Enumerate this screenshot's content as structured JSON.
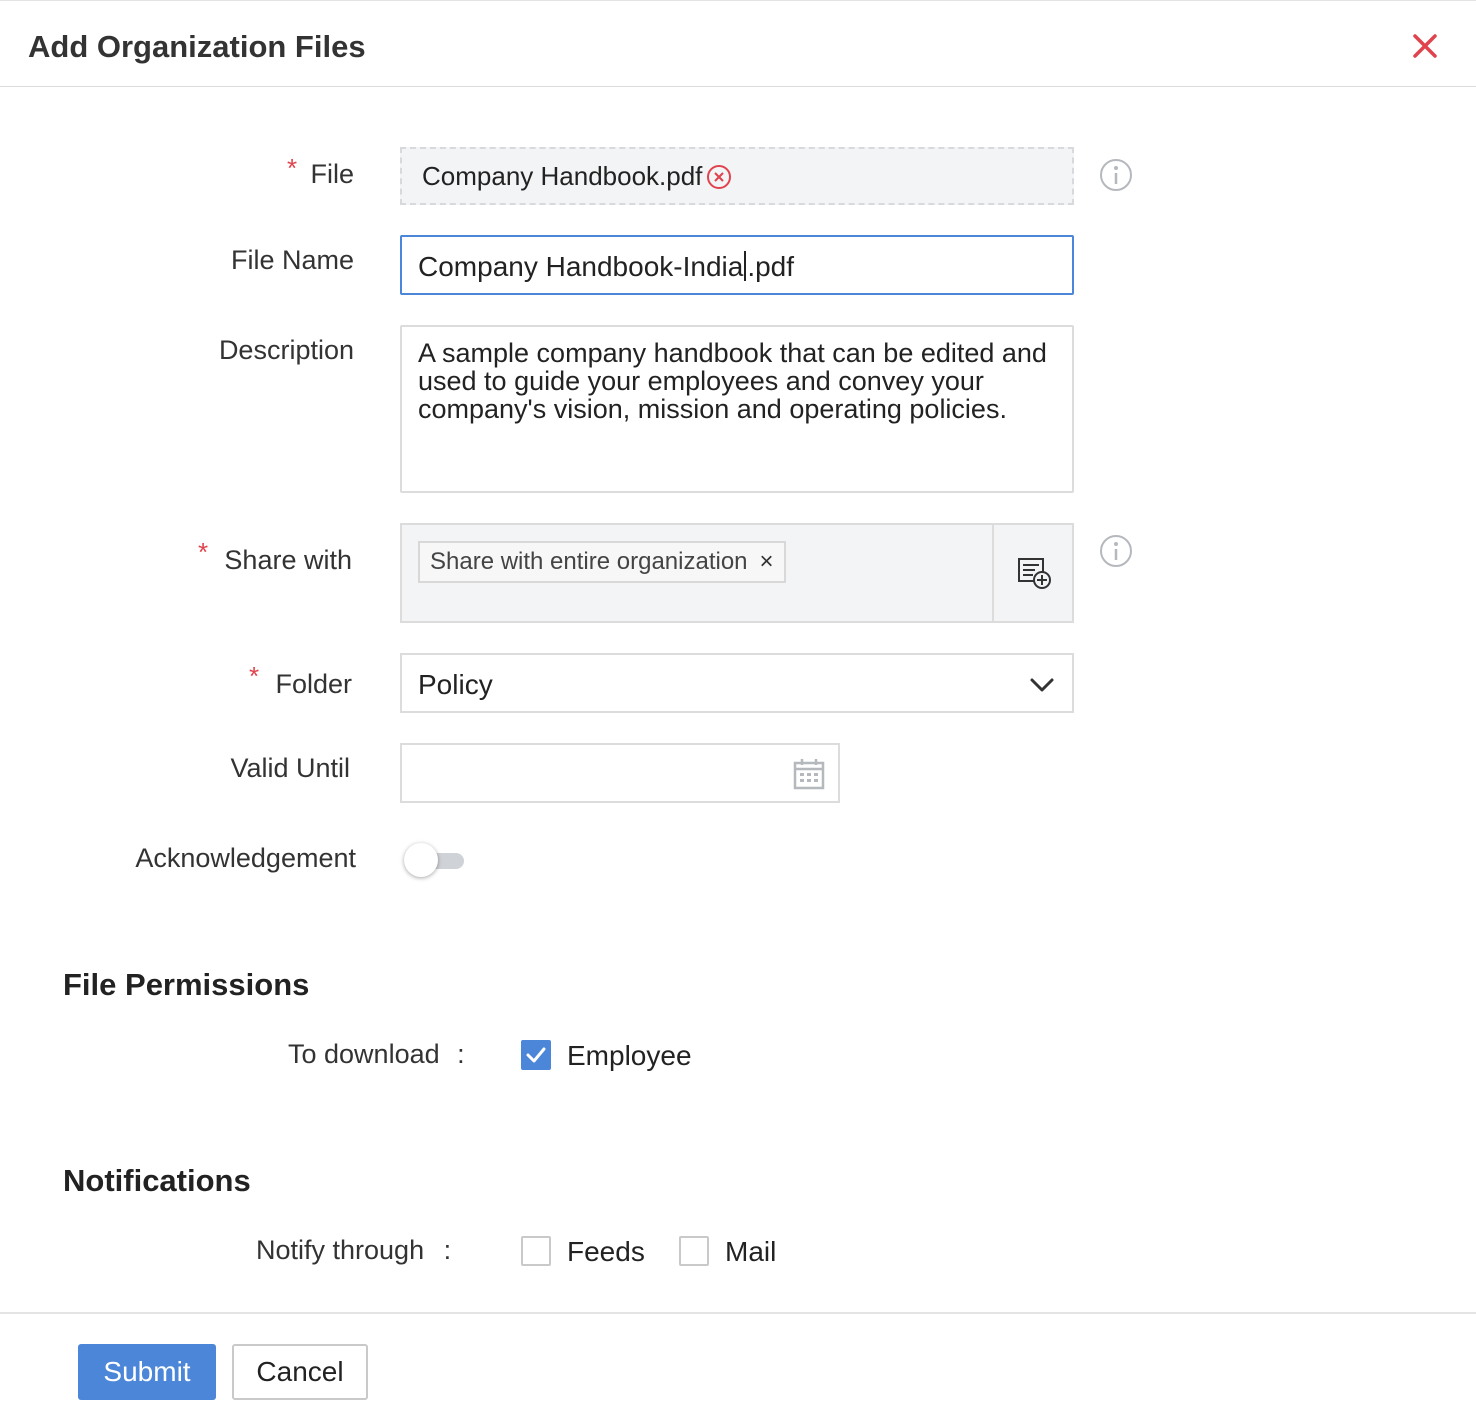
{
  "dialog": {
    "title": "Add Organization Files"
  },
  "form": {
    "file": {
      "required_mark": "*",
      "label": "File",
      "value": "Company Handbook.pdf"
    },
    "file_name": {
      "label": "File Name",
      "value_before_caret": "Company Handbook-India",
      "value_after_caret": ".pdf"
    },
    "description": {
      "label": "Description",
      "value": "A sample company handbook that can be edited and used to guide your employees and convey your company's vision, mission and operating policies."
    },
    "share_with": {
      "required_mark": "*",
      "label": "Share with",
      "tag": "Share with entire organization",
      "tag_remove": "×"
    },
    "folder": {
      "required_mark": "*",
      "label": "Folder",
      "value": "Policy"
    },
    "valid_until": {
      "label": "Valid Until",
      "value": ""
    },
    "acknowledgement": {
      "label": "Acknowledgement",
      "enabled": false
    }
  },
  "file_permissions": {
    "title": "File Permissions",
    "to_download_label": "To download",
    "separator": ":",
    "options": [
      {
        "label": "Employee",
        "checked": true
      }
    ]
  },
  "notifications": {
    "title": "Notifications",
    "notify_label": "Notify through",
    "separator": ":",
    "options": [
      {
        "label": "Feeds",
        "checked": false
      },
      {
        "label": "Mail",
        "checked": false
      }
    ]
  },
  "footer": {
    "submit_label": "Submit",
    "cancel_label": "Cancel"
  },
  "colors": {
    "accent": "#4c86d8",
    "required": "#e0434d",
    "close": "#e0434d",
    "field_bg": "#f3f4f6"
  },
  "icons": {
    "close": "close-icon",
    "file_remove": "remove-circle-icon",
    "info": "info-icon",
    "share_add": "add-list-icon",
    "folder_chevron": "chevron-down-icon",
    "calendar": "calendar-icon",
    "check": "check-icon"
  }
}
